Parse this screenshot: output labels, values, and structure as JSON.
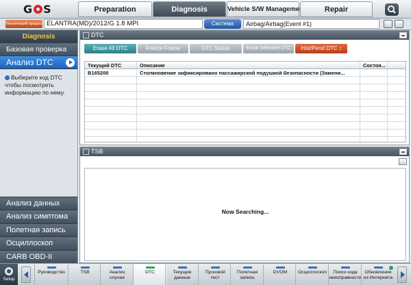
{
  "app": {
    "logo": "GDS"
  },
  "top_tabs": [
    {
      "label": "Preparation"
    },
    {
      "label": "Diagnosis"
    },
    {
      "label": "Vehicle S/W Management"
    },
    {
      "label": "Repair"
    }
  ],
  "vehicle_bar": {
    "vehicle_button": "Технический процесс",
    "vehicle": "ELANTRA(MD)/2012/G 1.8 MPI",
    "system_button": "Система",
    "system": "Airbag/Airbag(Event #1)"
  },
  "sidebar": {
    "header": "Diagnosis",
    "items": [
      {
        "label": "Базовая проверка"
      },
      {
        "label": "Анализ DTC"
      }
    ],
    "help_text": "Выберите код DTC чтобы посмотреть информацию по нему.",
    "bottom_items": [
      {
        "label": "Анализ данных"
      },
      {
        "label": "Анализ симптома"
      },
      {
        "label": "Полетная запись"
      },
      {
        "label": "Осциллоскоп"
      },
      {
        "label": "CARB OBD-II"
      }
    ]
  },
  "dtc_panel": {
    "title": "DTC",
    "buttons": {
      "erase_all": "Erase All DTC",
      "freeze_frame": "Freeze Frame",
      "dtc_status": "DTC Status",
      "erase_selective": "Erase Selective DTC",
      "hist_pend": "Hist/Pend DTC ↕"
    },
    "columns": [
      "Текущий DTC",
      "Описание",
      "Состоя..."
    ],
    "rows": [
      {
        "code": "B165200",
        "description": "Столкновение зафиксировано пассажирской подушкой безопасности (Замени...",
        "status": ""
      }
    ]
  },
  "tsb_panel": {
    "title": "TSB",
    "status": "Now Searching..."
  },
  "bottom_toolbar": {
    "setup": "Setup",
    "tools": [
      {
        "label1": "Руководство",
        "label2": ""
      },
      {
        "label1": "TSB",
        "label2": ""
      },
      {
        "label1": "Анализ",
        "label2": "случая"
      },
      {
        "label1": "DTC",
        "label2": ""
      },
      {
        "label1": "Текущие",
        "label2": "данные"
      },
      {
        "label1": "Пусковой",
        "label2": "тест"
      },
      {
        "label1": "Полетная",
        "label2": "запись"
      },
      {
        "label1": "DVOM",
        "label2": ""
      },
      {
        "label1": "Осциллоскоп",
        "label2": ""
      },
      {
        "label1": "Поиск кода",
        "label2": "неисправности"
      },
      {
        "label1": "Обновление",
        "label2": "из Интернета"
      }
    ]
  },
  "colors": {
    "active_tab": "#3d4955",
    "sidebar_active": "#1b62bf",
    "logo_red": "#d8282a",
    "erase_all": "#2d7f89",
    "hist_pend": "#b93d17"
  }
}
